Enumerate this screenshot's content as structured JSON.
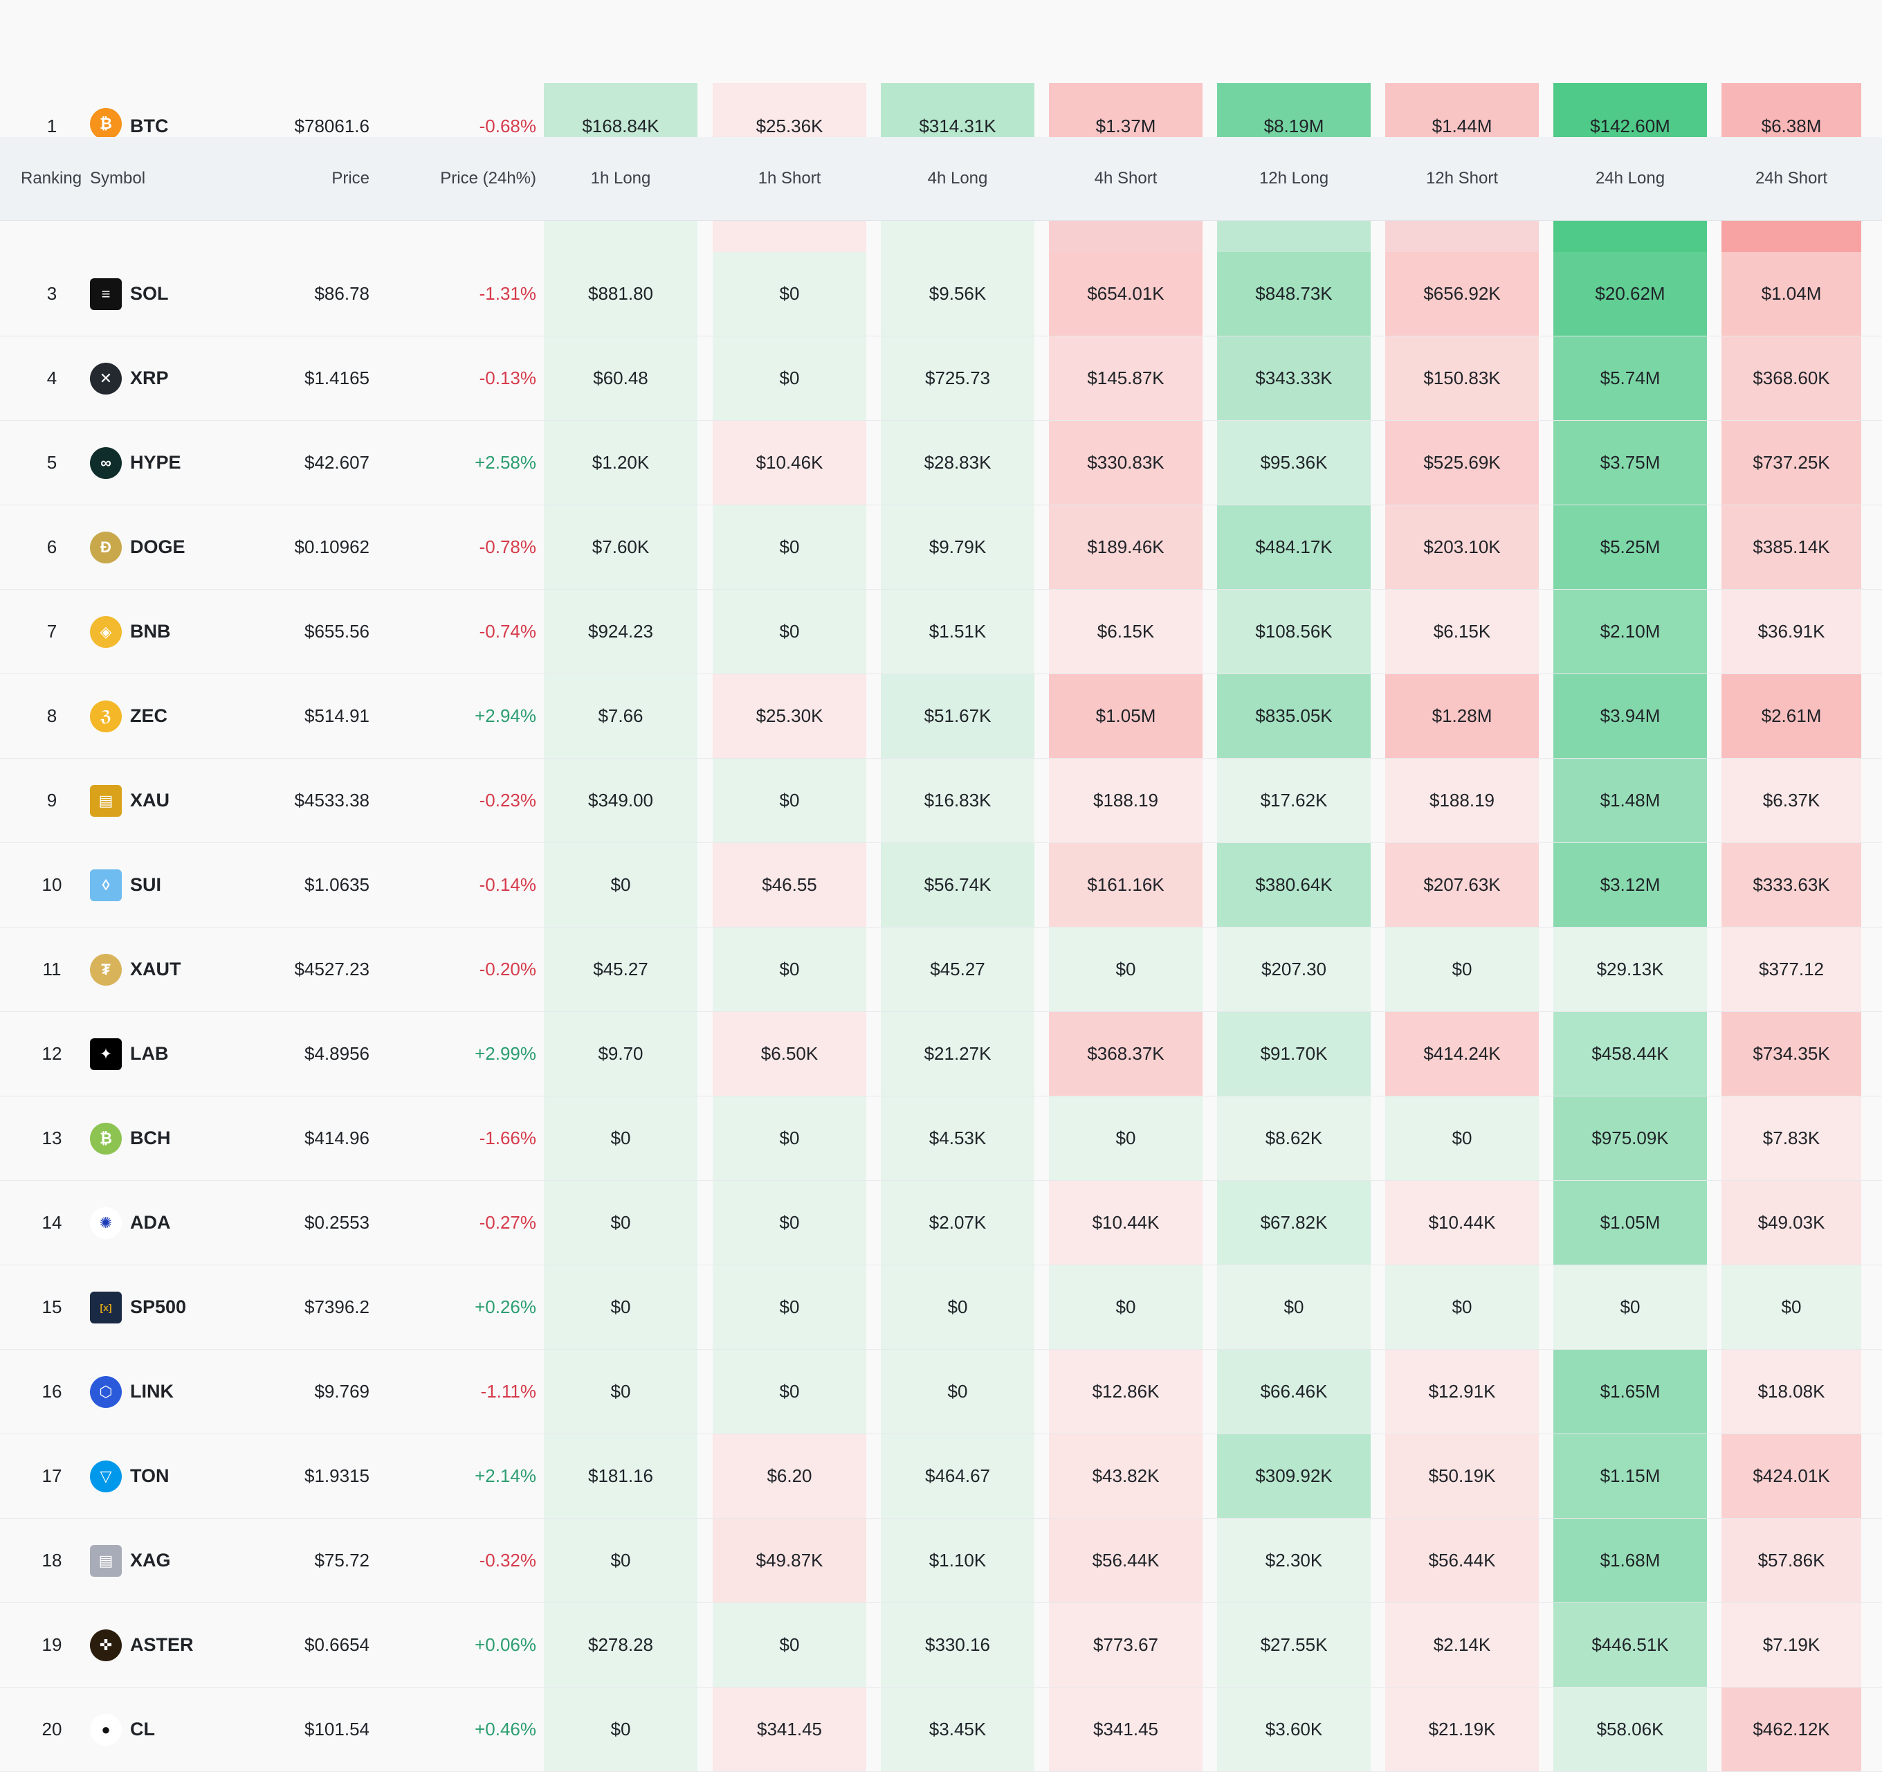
{
  "header": {
    "ranking": "Ranking",
    "symbol": "Symbol",
    "price": "Price",
    "change": "Price (24h%)",
    "h1_long": "1h Long",
    "h1_short": "1h Short",
    "h4_long": "4h Long",
    "h4_short": "4h Short",
    "h12_long": "12h Long",
    "h12_short": "12h Short",
    "h24_long": "24h Long",
    "h24_short": "24h Short"
  },
  "colors": {
    "positive": "#2c9e70",
    "negative": "#d63b4b",
    "long_light": "#e6f4ec",
    "short_light": "#fbe8e8"
  },
  "rows": [
    {
      "rank": "1",
      "symbol": "BTC",
      "icon": "bitcoin-icon",
      "price": "$78061.6",
      "change": "-0.68%",
      "dir": "neg",
      "cells": [
        "$168.84K",
        "$25.36K",
        "$314.31K",
        "$1.37M",
        "$8.19M",
        "$1.44M",
        "$142.60M",
        "$6.38M"
      ]
    },
    {
      "rank": "3",
      "symbol": "SOL",
      "icon": "solana-icon",
      "price": "$86.78",
      "change": "-1.31%",
      "dir": "neg",
      "cells": [
        "$881.80",
        "$0",
        "$9.56K",
        "$654.01K",
        "$848.73K",
        "$656.92K",
        "$20.62M",
        "$1.04M"
      ]
    },
    {
      "rank": "4",
      "symbol": "XRP",
      "icon": "xrp-icon",
      "price": "$1.4165",
      "change": "-0.13%",
      "dir": "neg",
      "cells": [
        "$60.48",
        "$0",
        "$725.73",
        "$145.87K",
        "$343.33K",
        "$150.83K",
        "$5.74M",
        "$368.60K"
      ]
    },
    {
      "rank": "5",
      "symbol": "HYPE",
      "icon": "hyperliquid-icon",
      "price": "$42.607",
      "change": "+2.58%",
      "dir": "pos",
      "cells": [
        "$1.20K",
        "$10.46K",
        "$28.83K",
        "$330.83K",
        "$95.36K",
        "$525.69K",
        "$3.75M",
        "$737.25K"
      ]
    },
    {
      "rank": "6",
      "symbol": "DOGE",
      "icon": "dogecoin-icon",
      "price": "$0.10962",
      "change": "-0.78%",
      "dir": "neg",
      "cells": [
        "$7.60K",
        "$0",
        "$9.79K",
        "$189.46K",
        "$484.17K",
        "$203.10K",
        "$5.25M",
        "$385.14K"
      ]
    },
    {
      "rank": "7",
      "symbol": "BNB",
      "icon": "bnb-icon",
      "price": "$655.56",
      "change": "-0.74%",
      "dir": "neg",
      "cells": [
        "$924.23",
        "$0",
        "$1.51K",
        "$6.15K",
        "$108.56K",
        "$6.15K",
        "$2.10M",
        "$36.91K"
      ]
    },
    {
      "rank": "8",
      "symbol": "ZEC",
      "icon": "zcash-icon",
      "price": "$514.91",
      "change": "+2.94%",
      "dir": "pos",
      "cells": [
        "$7.66",
        "$25.30K",
        "$51.67K",
        "$1.05M",
        "$835.05K",
        "$1.28M",
        "$3.94M",
        "$2.61M"
      ]
    },
    {
      "rank": "9",
      "symbol": "XAU",
      "icon": "gold-icon",
      "price": "$4533.38",
      "change": "-0.23%",
      "dir": "neg",
      "cells": [
        "$349.00",
        "$0",
        "$16.83K",
        "$188.19",
        "$17.62K",
        "$188.19",
        "$1.48M",
        "$6.37K"
      ]
    },
    {
      "rank": "10",
      "symbol": "SUI",
      "icon": "sui-icon",
      "price": "$1.0635",
      "change": "-0.14%",
      "dir": "neg",
      "cells": [
        "$0",
        "$46.55",
        "$56.74K",
        "$161.16K",
        "$380.64K",
        "$207.63K",
        "$3.12M",
        "$333.63K"
      ]
    },
    {
      "rank": "11",
      "symbol": "XAUT",
      "icon": "tether-gold-icon",
      "price": "$4527.23",
      "change": "-0.20%",
      "dir": "neg",
      "cells": [
        "$45.27",
        "$0",
        "$45.27",
        "$0",
        "$207.30",
        "$0",
        "$29.13K",
        "$377.12"
      ]
    },
    {
      "rank": "12",
      "symbol": "LAB",
      "icon": "lab-icon",
      "price": "$4.8956",
      "change": "+2.99%",
      "dir": "pos",
      "cells": [
        "$9.70",
        "$6.50K",
        "$21.27K",
        "$368.37K",
        "$91.70K",
        "$414.24K",
        "$458.44K",
        "$734.35K"
      ]
    },
    {
      "rank": "13",
      "symbol": "BCH",
      "icon": "bitcoin-cash-icon",
      "price": "$414.96",
      "change": "-1.66%",
      "dir": "neg",
      "cells": [
        "$0",
        "$0",
        "$4.53K",
        "$0",
        "$8.62K",
        "$0",
        "$975.09K",
        "$7.83K"
      ]
    },
    {
      "rank": "14",
      "symbol": "ADA",
      "icon": "cardano-icon",
      "price": "$0.2553",
      "change": "-0.27%",
      "dir": "neg",
      "cells": [
        "$0",
        "$0",
        "$2.07K",
        "$10.44K",
        "$67.82K",
        "$10.44K",
        "$1.05M",
        "$49.03K"
      ]
    },
    {
      "rank": "15",
      "symbol": "SP500",
      "icon": "xyz-icon",
      "price": "$7396.2",
      "change": "+0.26%",
      "dir": "pos",
      "cells": [
        "$0",
        "$0",
        "$0",
        "$0",
        "$0",
        "$0",
        "$0",
        "$0"
      ]
    },
    {
      "rank": "16",
      "symbol": "LINK",
      "icon": "chainlink-icon",
      "price": "$9.769",
      "change": "-1.11%",
      "dir": "neg",
      "cells": [
        "$0",
        "$0",
        "$0",
        "$12.86K",
        "$66.46K",
        "$12.91K",
        "$1.65M",
        "$18.08K"
      ]
    },
    {
      "rank": "17",
      "symbol": "TON",
      "icon": "toncoin-icon",
      "price": "$1.9315",
      "change": "+2.14%",
      "dir": "pos",
      "cells": [
        "$181.16",
        "$6.20",
        "$464.67",
        "$43.82K",
        "$309.92K",
        "$50.19K",
        "$1.15M",
        "$424.01K"
      ]
    },
    {
      "rank": "18",
      "symbol": "XAG",
      "icon": "silver-icon",
      "price": "$75.72",
      "change": "-0.32%",
      "dir": "neg",
      "cells": [
        "$0",
        "$49.87K",
        "$1.10K",
        "$56.44K",
        "$2.30K",
        "$56.44K",
        "$1.68M",
        "$57.86K"
      ]
    },
    {
      "rank": "19",
      "symbol": "ASTER",
      "icon": "aster-icon",
      "price": "$0.6654",
      "change": "+0.06%",
      "dir": "pos",
      "cells": [
        "$278.28",
        "$0",
        "$330.16",
        "$773.67",
        "$27.55K",
        "$2.14K",
        "$446.51K",
        "$7.19K"
      ]
    },
    {
      "rank": "20",
      "symbol": "CL",
      "icon": "crude-oil-icon",
      "price": "$101.54",
      "change": "+0.46%",
      "dir": "pos",
      "cells": [
        "$0",
        "$341.45",
        "$3.45K",
        "$341.45",
        "$3.60K",
        "$21.19K",
        "$58.06K",
        "$462.12K"
      ]
    }
  ]
}
